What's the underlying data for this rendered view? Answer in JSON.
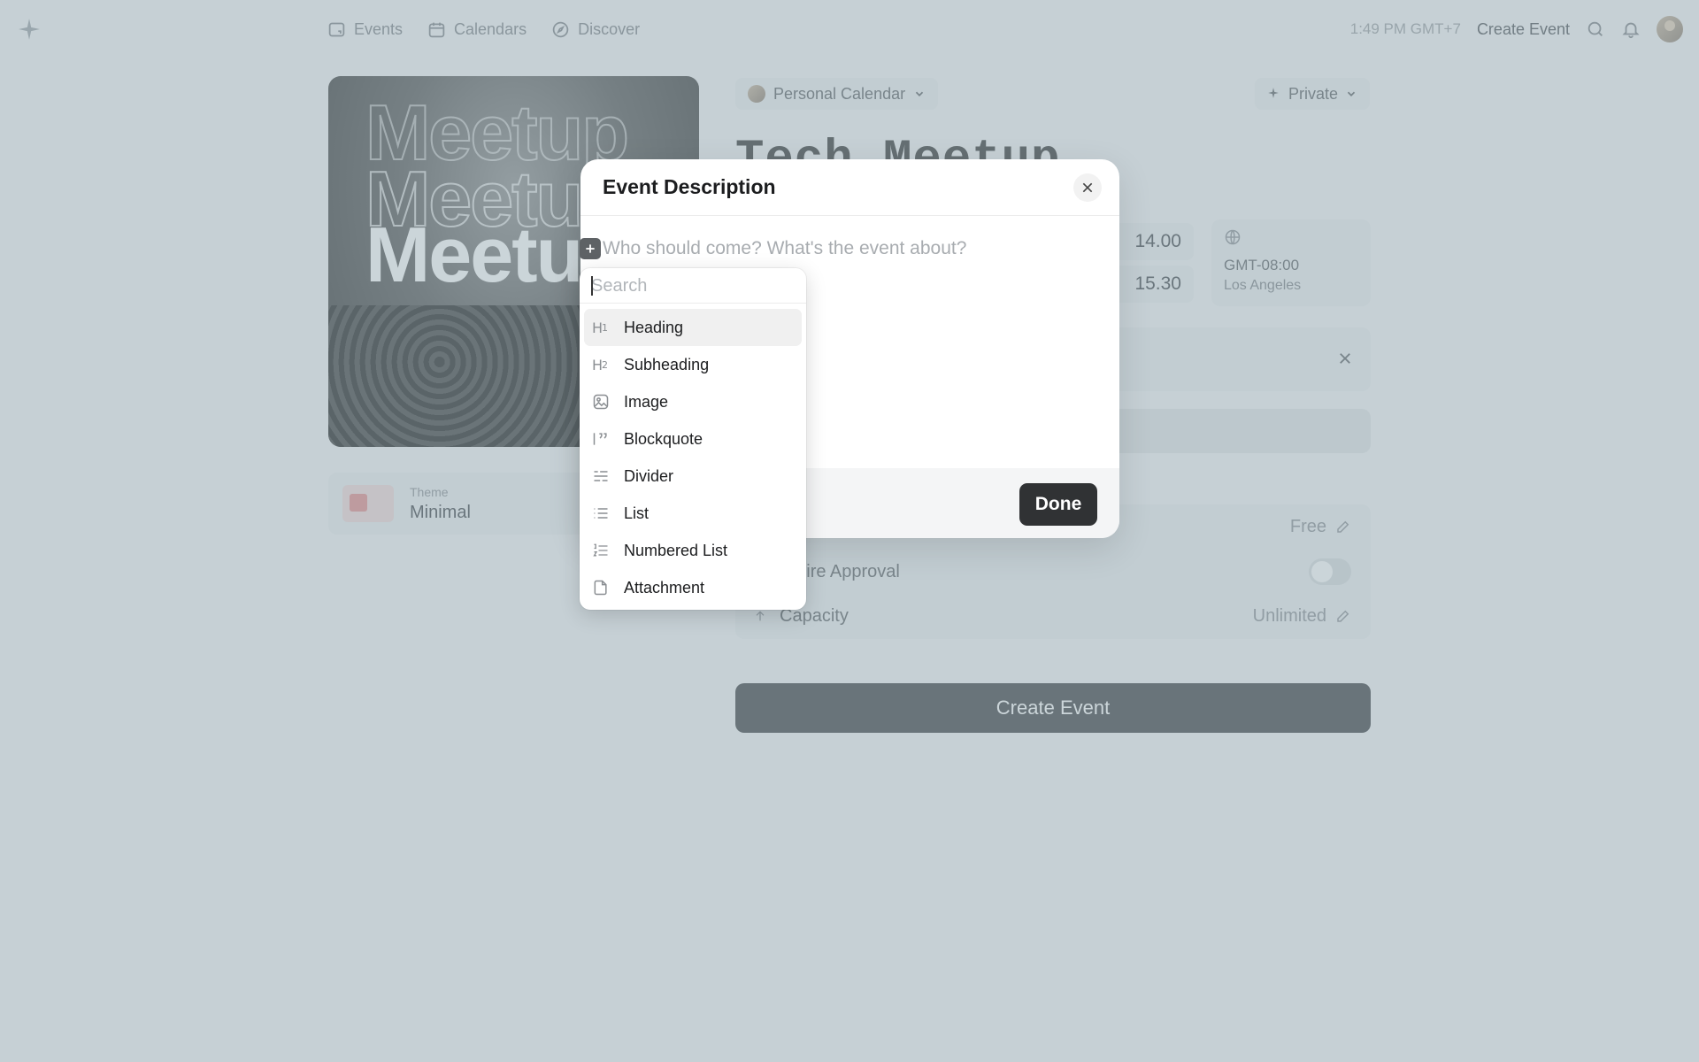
{
  "topbar": {
    "nav": [
      {
        "label": "Events",
        "icon": "events-icon"
      },
      {
        "label": "Calendars",
        "icon": "calendar-icon"
      },
      {
        "label": "Discover",
        "icon": "compass-icon"
      }
    ],
    "time": "1:49 PM GMT+7",
    "create_event": "Create Event"
  },
  "cover": {
    "word": "Meetup"
  },
  "theme": {
    "label": "Theme",
    "value": "Minimal"
  },
  "calendar_select": {
    "label": "Personal Calendar"
  },
  "visibility": {
    "label": "Private"
  },
  "event": {
    "title": "Tech Meetup"
  },
  "times": {
    "start": "14.00",
    "end": "15.30"
  },
  "timezone": {
    "offset": "GMT-08:00",
    "city": "Los Angeles"
  },
  "options": {
    "tickets": {
      "value": "Free"
    },
    "approval": {
      "label": "Require Approval",
      "visible_label": "quire Approval"
    },
    "capacity": {
      "label": "Capacity",
      "value": "Unlimited"
    }
  },
  "create_button": "Create Event",
  "modal": {
    "title": "Event Description",
    "placeholder": "Who should come? What's the event about?",
    "done": "Done"
  },
  "slash_menu": {
    "search_placeholder": "Search",
    "items": [
      {
        "label": "Heading",
        "icon": "heading1-icon",
        "active": true
      },
      {
        "label": "Subheading",
        "icon": "heading2-icon"
      },
      {
        "label": "Image",
        "icon": "image-icon"
      },
      {
        "label": "Blockquote",
        "icon": "blockquote-icon"
      },
      {
        "label": "Divider",
        "icon": "divider-icon"
      },
      {
        "label": "List",
        "icon": "list-icon"
      },
      {
        "label": "Numbered List",
        "icon": "numbered-list-icon"
      },
      {
        "label": "Attachment",
        "icon": "attachment-icon"
      }
    ]
  },
  "colors": {
    "overlay": "#98acb4",
    "primary_button": "#303234",
    "menu_active": "#f0f0f0"
  }
}
